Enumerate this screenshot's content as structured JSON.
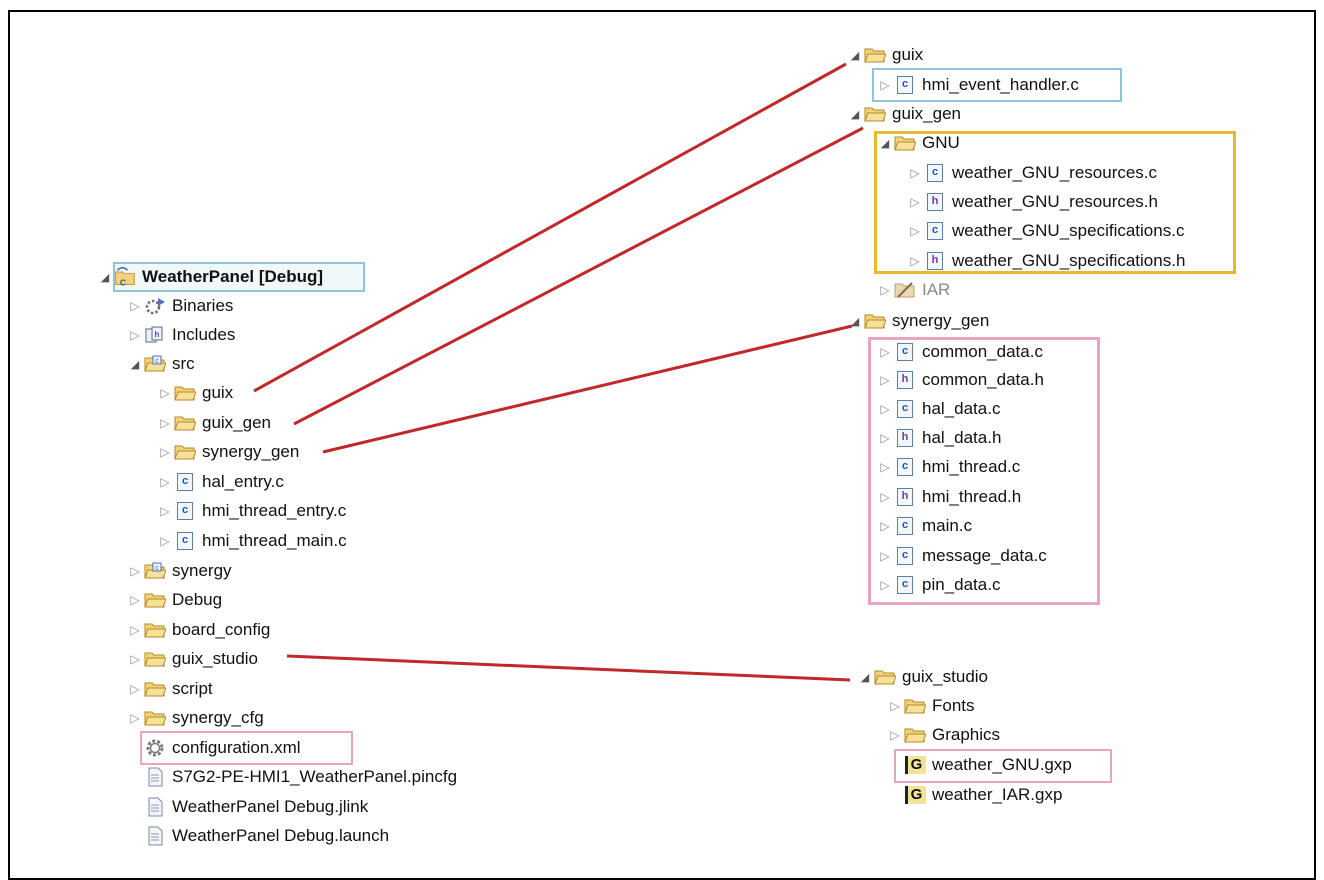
{
  "project_tree": {
    "root": {
      "label": "WeatherPanel [Debug]",
      "icon": "project-icon"
    },
    "items": [
      {
        "label": "Binaries",
        "icon": "binaries-icon"
      },
      {
        "label": "Includes",
        "icon": "includes-icon"
      },
      {
        "label": "src",
        "icon": "source-folder-icon"
      },
      {
        "label": "guix",
        "icon": "folder-icon"
      },
      {
        "label": "guix_gen",
        "icon": "folder-icon"
      },
      {
        "label": "synergy_gen",
        "icon": "folder-icon"
      },
      {
        "label": "hal_entry.c",
        "icon": "c-file-icon"
      },
      {
        "label": "hmi_thread_entry.c",
        "icon": "c-file-icon"
      },
      {
        "label": "hmi_thread_main.c",
        "icon": "c-file-icon"
      },
      {
        "label": "synergy",
        "icon": "source-folder-icon"
      },
      {
        "label": "Debug",
        "icon": "folder-icon"
      },
      {
        "label": "board_config",
        "icon": "folder-icon"
      },
      {
        "label": "guix_studio",
        "icon": "folder-icon"
      },
      {
        "label": "script",
        "icon": "folder-icon"
      },
      {
        "label": "synergy_cfg",
        "icon": "folder-icon"
      },
      {
        "label": "configuration.xml",
        "icon": "gear-icon"
      },
      {
        "label": "S7G2-PE-HMI1_WeatherPanel.pincfg",
        "icon": "document-icon"
      },
      {
        "label": "WeatherPanel Debug.jlink",
        "icon": "document-icon"
      },
      {
        "label": "WeatherPanel Debug.launch",
        "icon": "document-icon"
      }
    ]
  },
  "guix_detail": [
    {
      "label": "guix",
      "icon": "folder-icon"
    },
    {
      "label": "hmi_event_handler.c",
      "icon": "c-file-icon"
    }
  ],
  "guix_gen_detail": [
    {
      "label": "guix_gen",
      "icon": "folder-icon"
    },
    {
      "label": "GNU",
      "icon": "folder-icon"
    },
    {
      "label": "weather_GNU_resources.c",
      "icon": "c-file-icon"
    },
    {
      "label": "weather_GNU_resources.h",
      "icon": "h-file-icon"
    },
    {
      "label": "weather_GNU_specifications.c",
      "icon": "c-file-icon"
    },
    {
      "label": "weather_GNU_specifications.h",
      "icon": "h-file-icon"
    },
    {
      "label": "IAR",
      "icon": "excluded-folder-icon"
    }
  ],
  "synergy_gen_detail": [
    {
      "label": "synergy_gen",
      "icon": "folder-icon"
    },
    {
      "label": "common_data.c",
      "icon": "c-file-icon"
    },
    {
      "label": "common_data.h",
      "icon": "h-file-icon"
    },
    {
      "label": "hal_data.c",
      "icon": "c-file-icon"
    },
    {
      "label": "hal_data.h",
      "icon": "h-file-icon"
    },
    {
      "label": "hmi_thread.c",
      "icon": "c-file-icon"
    },
    {
      "label": "hmi_thread.h",
      "icon": "h-file-icon"
    },
    {
      "label": "main.c",
      "icon": "c-file-icon"
    },
    {
      "label": "message_data.c",
      "icon": "c-file-icon"
    },
    {
      "label": "pin_data.c",
      "icon": "c-file-icon"
    }
  ],
  "guix_studio_detail": [
    {
      "label": "guix_studio",
      "icon": "folder-icon"
    },
    {
      "label": "Fonts",
      "icon": "folder-icon"
    },
    {
      "label": "Graphics",
      "icon": "folder-icon"
    },
    {
      "label": "weather_GNU.gxp",
      "icon": "guix-project-icon"
    },
    {
      "label": "weather_IAR.gxp",
      "icon": "guix-project-icon"
    }
  ],
  "colors": {
    "connector": "#c0282a",
    "highlight_blue": "#8ec6d8",
    "highlight_gold": "#e8b830",
    "highlight_pink": "#e8a4c0",
    "folder": "#e9c35a",
    "c_file": "#1c58a8",
    "h_file": "#6b3f9a"
  }
}
